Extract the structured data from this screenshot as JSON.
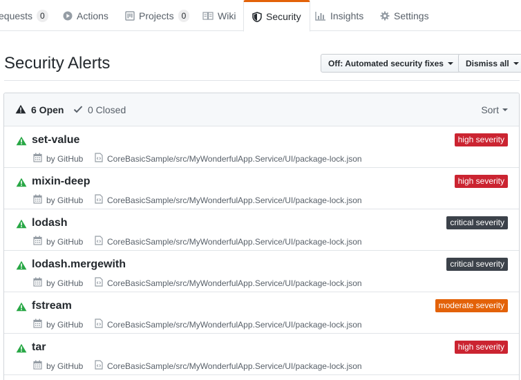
{
  "tabs": [
    {
      "label": "equests",
      "counter": "0",
      "icon": "pull-request-icon"
    },
    {
      "label": "Actions",
      "icon": "play-icon"
    },
    {
      "label": "Projects",
      "counter": "0",
      "icon": "project-icon"
    },
    {
      "label": "Wiki",
      "icon": "book-icon"
    },
    {
      "label": "Security",
      "icon": "shield-icon",
      "selected": true
    },
    {
      "label": "Insights",
      "icon": "graph-icon"
    },
    {
      "label": "Settings",
      "icon": "gear-icon"
    }
  ],
  "header": {
    "title": "Security Alerts",
    "auto_fix_button": "Off: Automated security fixes",
    "dismiss_button": "Dismiss all"
  },
  "filters": {
    "open_label": "6 Open",
    "closed_label": "0 Closed",
    "sort_label": "Sort"
  },
  "alerts": [
    {
      "name": "set-value",
      "severity": "high severity",
      "severity_color": "#cb2431",
      "by": "by GitHub",
      "path": "CoreBasicSample/src/MyWonderfulApp.Service/UI/package-lock.json"
    },
    {
      "name": "mixin-deep",
      "severity": "high severity",
      "severity_color": "#cb2431",
      "by": "by GitHub",
      "path": "CoreBasicSample/src/MyWonderfulApp.Service/UI/package-lock.json"
    },
    {
      "name": "lodash",
      "severity": "critical severity",
      "severity_color": "#3c424a",
      "by": "by GitHub",
      "path": "CoreBasicSample/src/MyWonderfulApp.Service/UI/package-lock.json"
    },
    {
      "name": "lodash.mergewith",
      "severity": "critical severity",
      "severity_color": "#3c424a",
      "by": "by GitHub",
      "path": "CoreBasicSample/src/MyWonderfulApp.Service/UI/package-lock.json"
    },
    {
      "name": "fstream",
      "severity": "moderate severity",
      "severity_color": "#e36209",
      "by": "by GitHub",
      "path": "CoreBasicSample/src/MyWonderfulApp.Service/UI/package-lock.json"
    },
    {
      "name": "tar",
      "severity": "high severity",
      "severity_color": "#cb2431",
      "by": "by GitHub",
      "path": "CoreBasicSample/src/MyWonderfulApp.Service/UI/package-lock.json"
    }
  ],
  "colors": {
    "alert_icon": "#28a745",
    "selected_tab_accent": "#e36209"
  }
}
